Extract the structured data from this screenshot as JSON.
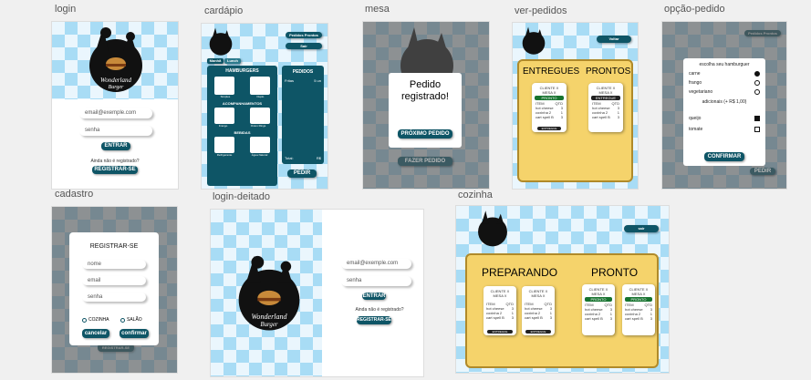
{
  "labels": {
    "login": "login",
    "cardapio": "cardápio",
    "mesa": "mesa",
    "ver_pedidos": "ver-pedidos",
    "opcao_pedido": "opção-pedido",
    "cadastro": "cadastro",
    "login_deitado": "login-deitado",
    "cozinha": "cozinha"
  },
  "brand": {
    "line1": "Wonderland",
    "line2": "Burger"
  },
  "login": {
    "email_placeholder": "email@exemple.com",
    "password_placeholder": "senha",
    "enter_button": "ENTRAR",
    "not_registered": "Ainda não é registrado?",
    "register_button": "REGISTRAR-SE"
  },
  "cardapio": {
    "orders_button": "Pedidos Prontos",
    "exit_button": "Sair",
    "tab_morning": "Manhã",
    "tab_lunch": "Lunch",
    "hamburgers_title": "HAMBURGERS",
    "sides_title": "ACOMPANHAMENTOS",
    "drinks_title": "BEBIDAS",
    "items": [
      "Simples",
      "Duplo",
      "Frango",
      "Onion Rings",
      "Refrigerante",
      "Água Natural"
    ],
    "orders_title": "PEDIDOS",
    "order_item": "Fritas",
    "order_qty": "5 un",
    "total_label": "Total:",
    "total_value": "R$",
    "order_button": "PEDIR"
  },
  "mesa": {
    "modal_text": "Pedido registrado!",
    "next_button": "PRÓXIMO PEDIDO",
    "make_order_button": "FAZER PEDIDO"
  },
  "ver_pedidos": {
    "back_button": "Voltar",
    "delivered": "ENTREGUES",
    "ready": "PRONTOS",
    "card_title": "CLIENTE X MESA X",
    "status_ready": "PRONTO",
    "status_delivered": "ENTREGUE",
    "col_item": "ITEM",
    "col_qtd": "QTD",
    "rows": [
      [
        "hot cheese",
        "3"
      ],
      [
        "coxinha 2",
        "1"
      ],
      [
        "cart spell B",
        "3"
      ]
    ],
    "deliver_button": "ENTREGUE"
  },
  "opcao_pedido": {
    "back_label": "Pedidos Prontos",
    "choose_title": "escolha seu hamburguer",
    "options": [
      "carne",
      "frango",
      "vegetariano"
    ],
    "add_title": "adicionais (+ R$ 1,00)",
    "adds": [
      "queijo",
      "tomate"
    ],
    "confirm_button": "CONFIRMAR",
    "order_button": "PEDIR"
  },
  "cadastro": {
    "title": "REGISTRAR-SE",
    "name": "nome",
    "email": "email",
    "password": "senha",
    "role_kitchen": "COZINHA",
    "role_hall": "SALÃO",
    "cancel_button": "cancelar",
    "confirm_button": "confirmar",
    "bg_button": "REGISTRAR-SE"
  },
  "login_deitado": {
    "email_placeholder": "email@exemple.com",
    "password_placeholder": "senha",
    "enter_button": "ENTRAR",
    "not_registered": "Ainda não é registrado?",
    "register_button": "REGISTRAR-SE"
  },
  "cozinha": {
    "exit_button": "sair",
    "preparing": "PREPARANDO",
    "ready": "PRONTO",
    "card_title": "CLIENTE X MESA X",
    "status_ready": "PRONTO",
    "col_item": "ITEM",
    "col_qtd": "QTD",
    "rows": [
      [
        "hot cheese",
        "3"
      ],
      [
        "coxinha 2",
        "1"
      ],
      [
        "cart spell B",
        "3"
      ]
    ],
    "deliver_button": "ENTREGUE"
  },
  "colors": {
    "teal": "#0e5566",
    "yellow": "#f5d36b",
    "green": "#17732f"
  }
}
